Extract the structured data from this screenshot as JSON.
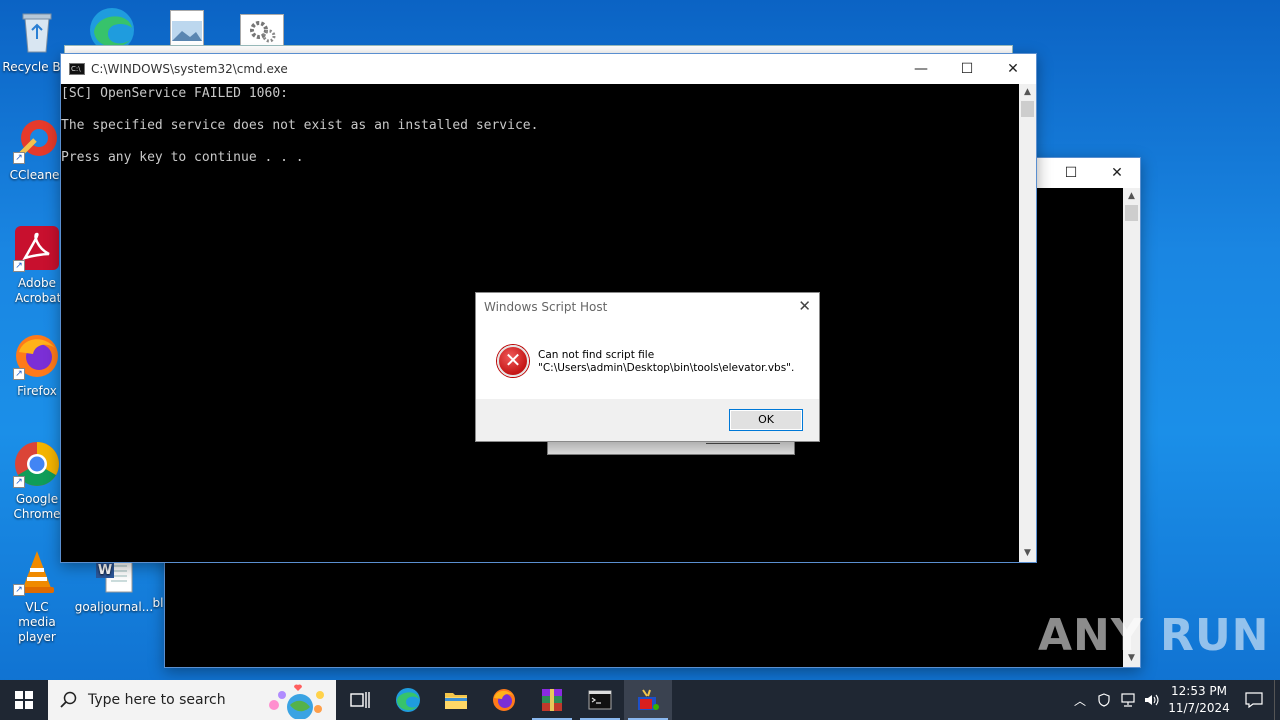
{
  "desktop": {
    "icons": [
      {
        "label": "Recycle Bin",
        "icon": "recycle-bin-icon"
      },
      {
        "label": "CCleaner",
        "icon": "ccleaner-icon"
      },
      {
        "label": "Adobe Acrobat",
        "icon": "adobe-acrobat-icon"
      },
      {
        "label": "Firefox",
        "icon": "firefox-icon"
      },
      {
        "label": "Google Chrome",
        "icon": "chrome-icon"
      },
      {
        "label": "VLC media player",
        "icon": "vlc-icon"
      },
      {
        "label": "goaljournal...",
        "icon": "word-doc-icon"
      },
      {
        "label": "bl",
        "icon": "file-icon"
      }
    ]
  },
  "cmd_window": {
    "title": "C:\\WINDOWS\\system32\\cmd.exe",
    "lines": [
      "[SC] OpenService FAILED 1060:",
      "",
      "The specified service does not exist as an installed service.",
      "",
      "Press any key to continue . . ."
    ],
    "minimize": "—",
    "maximize": "☐",
    "close": "✕"
  },
  "back_window": {
    "maximize": "☐",
    "close": "✕"
  },
  "dialog": {
    "title": "Windows Script Host",
    "close": "✕",
    "message_line1": "Can not find script file",
    "message_line2": "\"C:\\Users\\admin\\Desktop\\bin\\tools\\elevator.vbs\".",
    "ok_label": "OK"
  },
  "taskbar": {
    "search_placeholder": "Type here to search",
    "time": "12:53 PM",
    "date": "11/7/2024"
  },
  "watermark": "ANY RUN",
  "colors": {
    "desktop": "#1a86e2",
    "taskbar": "#1f2733",
    "accent": "#0078d7",
    "error": "#c41515"
  }
}
